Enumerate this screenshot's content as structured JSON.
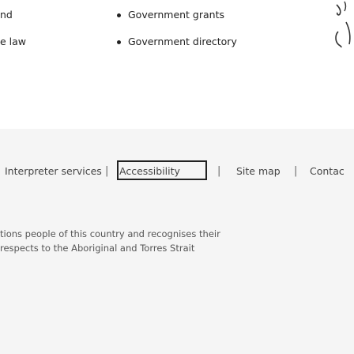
{
  "nav_links": {
    "left": [
      "nd",
      "e law"
    ],
    "right": [
      "Government grants",
      "Government directory"
    ]
  },
  "footer": {
    "links": [
      "Interpreter services",
      "Accessibility",
      "Site map",
      "Contac"
    ],
    "separator": "|"
  },
  "acknowledgement": {
    "line1": "tions people of this country and recognises their",
    "line2": "respects to the Aboriginal and Torres Strait"
  },
  "logo": {
    "icon": "emblem-icon"
  }
}
